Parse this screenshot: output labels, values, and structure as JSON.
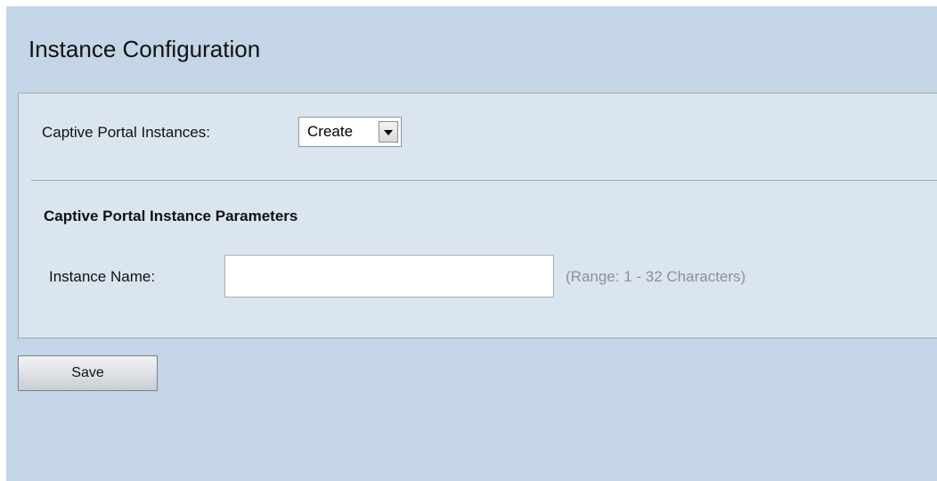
{
  "page": {
    "title": "Instance Configuration"
  },
  "instances": {
    "label": "Captive Portal Instances:",
    "selected": "Create",
    "arrow_icon": "dropdown-arrow-icon"
  },
  "params": {
    "section_title": "Captive Portal Instance Parameters",
    "instance_name_label": "Instance Name:",
    "instance_name_value": "",
    "instance_name_hint": "(Range: 1 - 32 Characters)"
  },
  "actions": {
    "save_label": "Save"
  },
  "colors": {
    "page_background": "#c3d5e6",
    "panel_background": "#dae5ef",
    "hint_text": "#8c9196"
  }
}
